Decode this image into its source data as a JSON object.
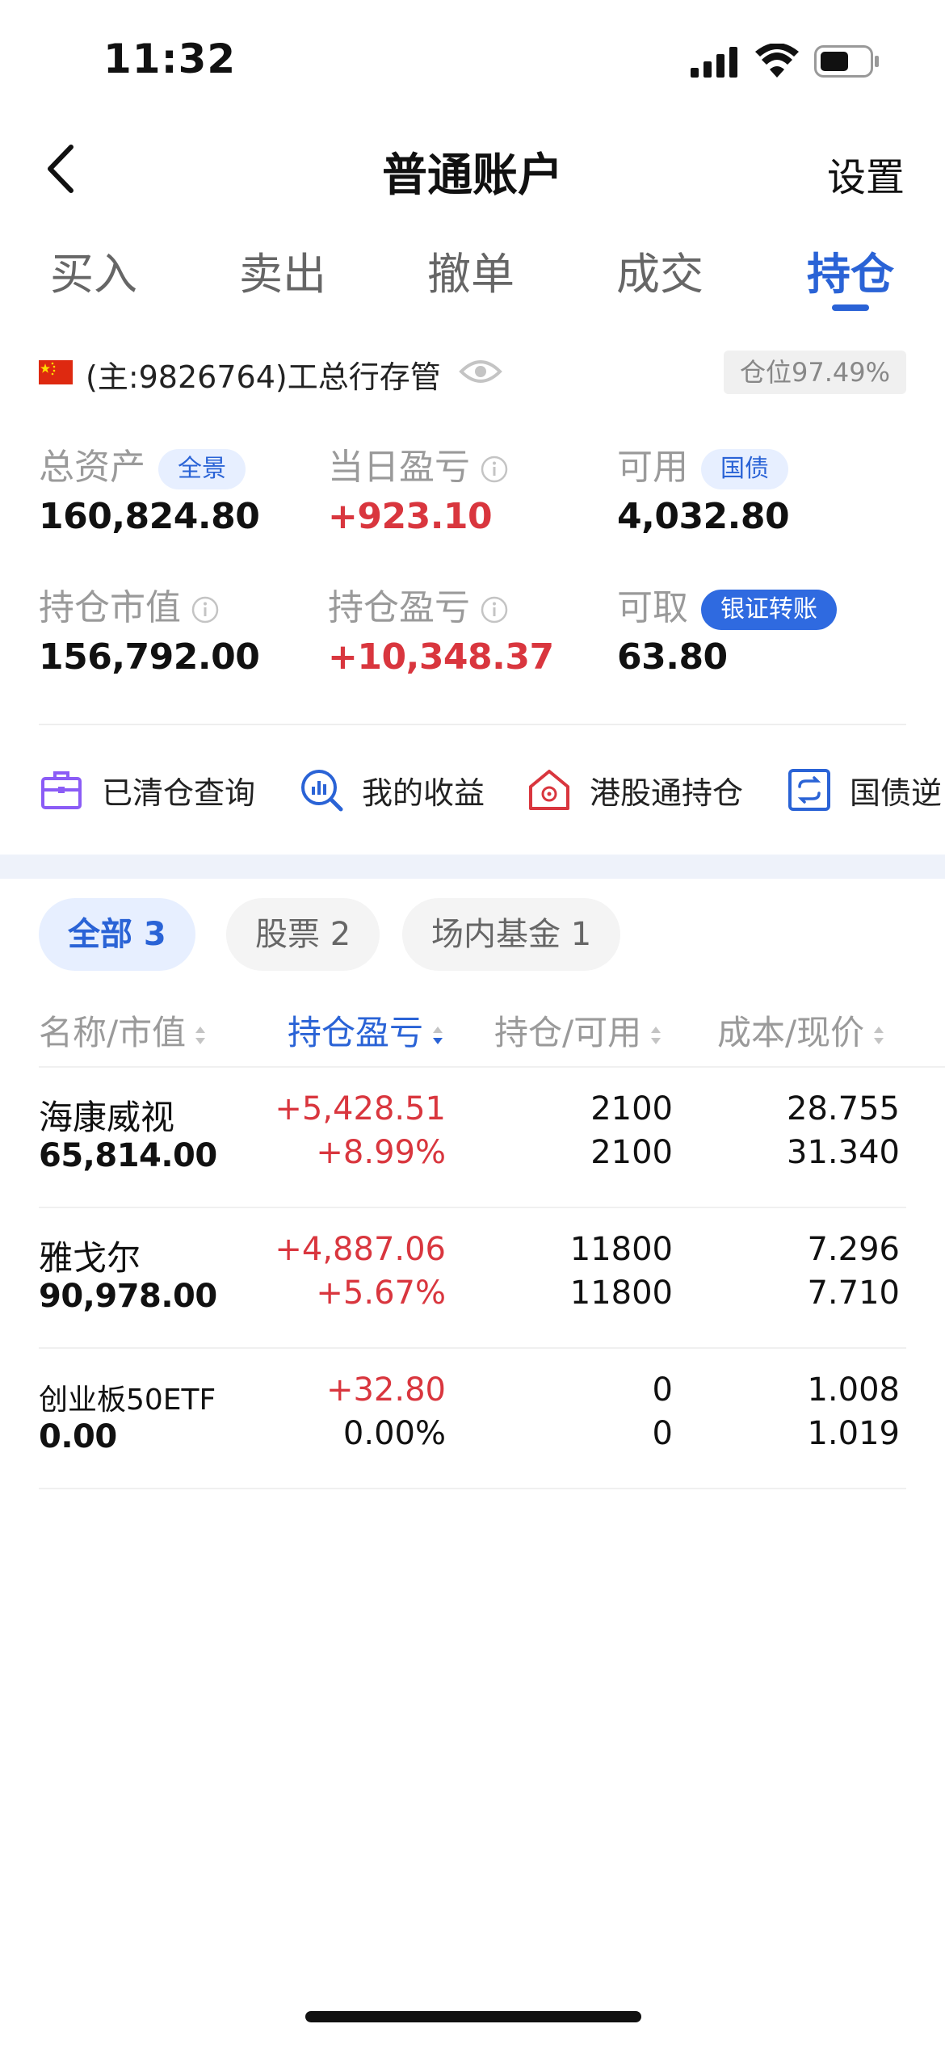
{
  "status_bar": {
    "time": "11:32"
  },
  "nav": {
    "title": "普通账户",
    "settings_label": "设置"
  },
  "tabs": [
    {
      "label": "买入"
    },
    {
      "label": "卖出"
    },
    {
      "label": "撤单"
    },
    {
      "label": "成交"
    },
    {
      "label": "持仓",
      "active": true
    }
  ],
  "account": {
    "name": "(主:9826764)工总行存管",
    "position_ratio": "仓位97.49%"
  },
  "stats": {
    "total_assets": {
      "label": "总资产",
      "tag": "全景",
      "value": "160,824.80"
    },
    "daily_pl": {
      "label": "当日盈亏",
      "value": "+923.10"
    },
    "available": {
      "label": "可用",
      "tag": "国债",
      "value": "4,032.80"
    },
    "holding_value": {
      "label": "持仓市值",
      "value": "156,792.00"
    },
    "holding_pl": {
      "label": "持仓盈亏",
      "value": "+10,348.37"
    },
    "withdrawable": {
      "label": "可取",
      "tag": "银证转账",
      "value": "63.80"
    }
  },
  "shortcuts": [
    {
      "label": "已清仓查询",
      "icon": "briefcase-icon"
    },
    {
      "label": "我的收益",
      "icon": "chart-search-icon"
    },
    {
      "label": "港股通持仓",
      "icon": "hk-house-icon"
    },
    {
      "label": "国债逆",
      "icon": "repo-cycle-icon"
    }
  ],
  "filters": [
    {
      "label": "全部 3",
      "active": true
    },
    {
      "label": "股票 2"
    },
    {
      "label": "场内基金 1"
    }
  ],
  "table": {
    "headers": [
      "名称/市值",
      "持仓盈亏",
      "持仓/可用",
      "成本/现价"
    ],
    "active_sort": "持仓盈亏",
    "rows": [
      {
        "name": "海康威视",
        "market_value": "65,814.00",
        "pl_amount": "+5,428.51",
        "pl_percent": "+8.99%",
        "holding": "2100",
        "available": "2100",
        "cost": "28.755",
        "price": "31.340"
      },
      {
        "name": "雅戈尔",
        "market_value": "90,978.00",
        "pl_amount": "+4,887.06",
        "pl_percent": "+5.67%",
        "holding": "11800",
        "available": "11800",
        "cost": "7.296",
        "price": "7.710"
      },
      {
        "name": "创业板50ETF",
        "market_value": "0.00",
        "pl_amount": "+32.80",
        "pl_percent": "0.00%",
        "holding": "0",
        "available": "0",
        "cost": "1.008",
        "price": "1.019"
      }
    ]
  },
  "colors": {
    "accent": "#2a63d6",
    "gain": "#d9363e",
    "muted": "#9a9a9a"
  }
}
